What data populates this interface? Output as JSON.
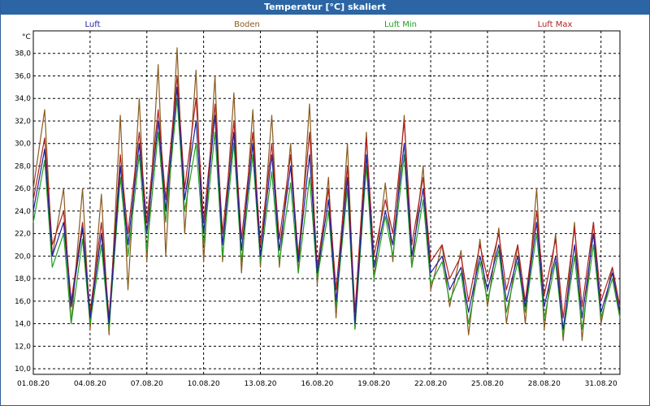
{
  "window": {
    "title": "Temperatur [°C] skaliert"
  },
  "colors": {
    "luft": "#1f1fa0",
    "boden": "#8a5a1e",
    "luft_min": "#1fa01f",
    "luft_max": "#b01f1f",
    "grid": "#000000"
  },
  "chart_data": {
    "type": "line",
    "title": "Temperatur [°C] skaliert",
    "ylabel": "°C",
    "xlabel": "",
    "ylim": [
      9.5,
      40
    ],
    "yticks": [
      "10,0",
      "12,0",
      "14,0",
      "16,0",
      "18,0",
      "20,0",
      "22,0",
      "24,0",
      "26,0",
      "28,0",
      "30,0",
      "32,0",
      "34,0",
      "36,0",
      "38,0"
    ],
    "ytick_values": [
      10,
      12,
      14,
      16,
      18,
      20,
      22,
      24,
      26,
      28,
      30,
      32,
      34,
      36,
      38
    ],
    "xticks": [
      "01.08.20",
      "04.08.20",
      "07.08.20",
      "10.08.20",
      "13.08.20",
      "16.08.20",
      "19.08.20",
      "22.08.20",
      "25.08.20",
      "28.08.20",
      "31.08.20"
    ],
    "xlim_days": [
      1,
      32
    ],
    "grid": true,
    "legend": [
      "Luft",
      "Boden",
      "Luft Min",
      "Luft Max"
    ],
    "series": [
      {
        "name": "Luft",
        "unit": "°C",
        "x_day": [
          1,
          1.6,
          2,
          2.6,
          3,
          3.6,
          4,
          4.6,
          5,
          5.6,
          6,
          6.6,
          7,
          7.6,
          8,
          8.6,
          9,
          9.6,
          10,
          10.6,
          11,
          11.6,
          12,
          12.6,
          13,
          13.6,
          14,
          14.6,
          15,
          15.6,
          16,
          16.6,
          17,
          17.6,
          18,
          18.6,
          19,
          19.6,
          20,
          20.6,
          21,
          21.6,
          22,
          22.6,
          23,
          23.6,
          24,
          24.6,
          25,
          25.6,
          26,
          26.6,
          27,
          27.6,
          28,
          28.6,
          29,
          29.6,
          30,
          30.6,
          31,
          31.6,
          32
        ],
        "values": [
          24,
          29.5,
          20,
          23,
          15.5,
          22.5,
          14.5,
          22,
          14,
          28,
          21,
          30,
          22,
          32,
          24,
          35,
          25,
          32,
          22,
          32.5,
          21,
          31,
          20.5,
          30,
          20,
          29,
          20.5,
          28,
          19.5,
          29,
          18.5,
          25,
          16,
          27,
          14,
          29,
          19,
          24,
          21,
          30,
          20,
          26,
          18.5,
          20,
          17,
          19,
          15,
          20,
          17,
          21,
          16,
          20,
          15.5,
          23,
          15.5,
          20,
          13.5,
          21,
          14.5,
          22,
          15,
          18.5,
          15
        ]
      },
      {
        "name": "Boden",
        "unit": "°C",
        "x_day": [
          1,
          1.6,
          2,
          2.6,
          3,
          3.6,
          4,
          4.6,
          5,
          5.6,
          6,
          6.6,
          7,
          7.6,
          8,
          8.6,
          9,
          9.6,
          10,
          10.6,
          11,
          11.6,
          12,
          12.6,
          13,
          13.6,
          14,
          14.6,
          15,
          15.6,
          16,
          16.6,
          17,
          17.6,
          18,
          18.6,
          19,
          19.6,
          20,
          20.6,
          21,
          21.6,
          22,
          22.6,
          23,
          23.6,
          24,
          24.6,
          25,
          25.6,
          26,
          26.6,
          27,
          27.6,
          28,
          28.6,
          29,
          29.6,
          30,
          30.6,
          31,
          31.6,
          32
        ],
        "values": [
          26,
          33,
          20,
          26,
          14,
          26,
          13.5,
          25.5,
          13,
          32.5,
          17,
          34,
          19.5,
          37,
          20,
          38.5,
          22,
          36.5,
          19.5,
          36,
          19.5,
          34.5,
          18.5,
          33,
          19,
          32.5,
          19,
          30,
          18.5,
          33.5,
          17.5,
          27,
          14.5,
          30,
          13.5,
          31,
          18,
          26.5,
          19.5,
          32.5,
          19,
          28,
          17,
          21,
          15.5,
          20.5,
          13,
          21.5,
          15.5,
          22.5,
          14,
          21,
          14,
          26,
          13.5,
          22,
          12.5,
          23,
          12.5,
          23,
          14,
          19,
          14.5
        ]
      },
      {
        "name": "Luft Min",
        "unit": "°C",
        "x_day": [
          1,
          1.6,
          2,
          2.6,
          3,
          3.6,
          4,
          4.6,
          5,
          5.6,
          6,
          6.6,
          7,
          7.6,
          8,
          8.6,
          9,
          9.6,
          10,
          10.6,
          11,
          11.6,
          12,
          12.6,
          13,
          13.6,
          14,
          14.6,
          15,
          15.6,
          16,
          16.6,
          17,
          17.6,
          18,
          18.6,
          19,
          19.6,
          20,
          20.6,
          21,
          21.6,
          22,
          22.6,
          23,
          23.6,
          24,
          24.6,
          25,
          25.6,
          26,
          26.6,
          27,
          27.6,
          28,
          28.6,
          29,
          29.6,
          30,
          30.6,
          31,
          31.6,
          32
        ],
        "values": [
          23,
          28.5,
          19,
          22,
          14,
          21.5,
          14,
          21,
          13.5,
          27,
          20,
          29,
          20.5,
          31,
          23,
          34,
          24,
          30,
          21,
          31,
          20,
          30,
          19.5,
          29,
          19.5,
          27.5,
          19.5,
          26.5,
          18.5,
          27,
          18,
          24,
          15.5,
          26,
          13.5,
          28,
          18,
          23.5,
          20,
          29,
          19,
          25,
          17.5,
          19.5,
          16,
          18.5,
          14,
          19.5,
          16,
          20.5,
          15,
          19.5,
          15,
          22,
          14.5,
          19.5,
          13,
          20,
          13.5,
          21,
          14.5,
          18,
          14.5
        ]
      },
      {
        "name": "Luft Max",
        "unit": "°C",
        "x_day": [
          1,
          1.6,
          2,
          2.6,
          3,
          3.6,
          4,
          4.6,
          5,
          5.6,
          6,
          6.6,
          7,
          7.6,
          8,
          8.6,
          9,
          9.6,
          10,
          10.6,
          11,
          11.6,
          12,
          12.6,
          13,
          13.6,
          14,
          14.6,
          15,
          15.6,
          16,
          16.6,
          17,
          17.6,
          18,
          18.6,
          19,
          19.6,
          20,
          20.6,
          21,
          21.6,
          22,
          22.6,
          23,
          23.6,
          24,
          24.6,
          25,
          25.6,
          26,
          26.6,
          27,
          27.6,
          28,
          28.6,
          29,
          29.6,
          30,
          30.6,
          31,
          31.6,
          32
        ],
        "values": [
          25,
          30.5,
          21,
          24,
          16,
          23,
          15,
          23,
          14.5,
          29,
          22,
          31,
          23,
          33,
          25,
          36,
          26,
          34,
          23,
          33.5,
          22,
          32,
          21.5,
          31,
          21,
          30,
          21.5,
          29,
          20,
          31,
          19,
          26,
          17,
          28,
          15,
          30.5,
          20,
          25,
          22,
          32,
          21,
          27,
          19.5,
          21,
          18,
          20,
          16,
          21,
          18,
          22,
          17,
          21,
          16,
          24,
          16.5,
          21.5,
          14.5,
          22.5,
          15.5,
          23,
          16,
          19,
          15.5
        ]
      }
    ]
  }
}
